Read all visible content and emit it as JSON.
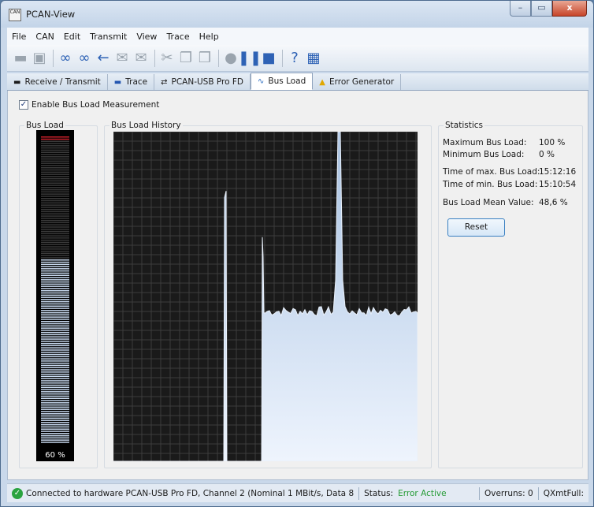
{
  "window": {
    "title": "PCAN-View"
  },
  "menu": [
    "File",
    "CAN",
    "Edit",
    "Transmit",
    "View",
    "Trace",
    "Help"
  ],
  "tabs": [
    {
      "label": "Receive / Transmit",
      "icon": "receive-transmit-icon"
    },
    {
      "label": "Trace",
      "icon": "trace-icon"
    },
    {
      "label": "PCAN-USB Pro FD",
      "icon": "usb-icon"
    },
    {
      "label": "Bus Load",
      "icon": "bus-load-icon",
      "selected": true
    },
    {
      "label": "Error Generator",
      "icon": "warning-icon"
    }
  ],
  "content": {
    "enable_label": "Enable Bus Load Measurement",
    "bus_load_label": "Bus Load",
    "history_label": "Bus Load History",
    "meter_value": "60 %",
    "meter_fraction": 0.6
  },
  "statistics": {
    "title": "Statistics",
    "max_label": "Maximum Bus Load:",
    "max_value": "100 %",
    "min_label": "Minimum Bus Load:",
    "min_value": "0 %",
    "time_max_label": "Time of max. Bus Load:",
    "time_max_value": "15:12:16",
    "time_min_label": "Time of min. Bus Load:",
    "time_min_value": "15:10:54",
    "mean_label": "Bus Load Mean Value:",
    "mean_value": "48,6 %",
    "reset_label": "Reset"
  },
  "status": {
    "connected": "Connected to hardware PCAN-USB Pro FD, Channel 2 (Nominal 1 MBit/s, Data 8",
    "status_label": "Status:",
    "status_value": "Error Active",
    "overruns": "Overruns: 0",
    "qxmt": "QXmtFull:"
  },
  "colors": {
    "history_bg": "#1a1a1a",
    "history_fill_top": "#a9c3e3",
    "history_fill_bottom": "#eef4fd",
    "status_green": "#249b34"
  }
}
